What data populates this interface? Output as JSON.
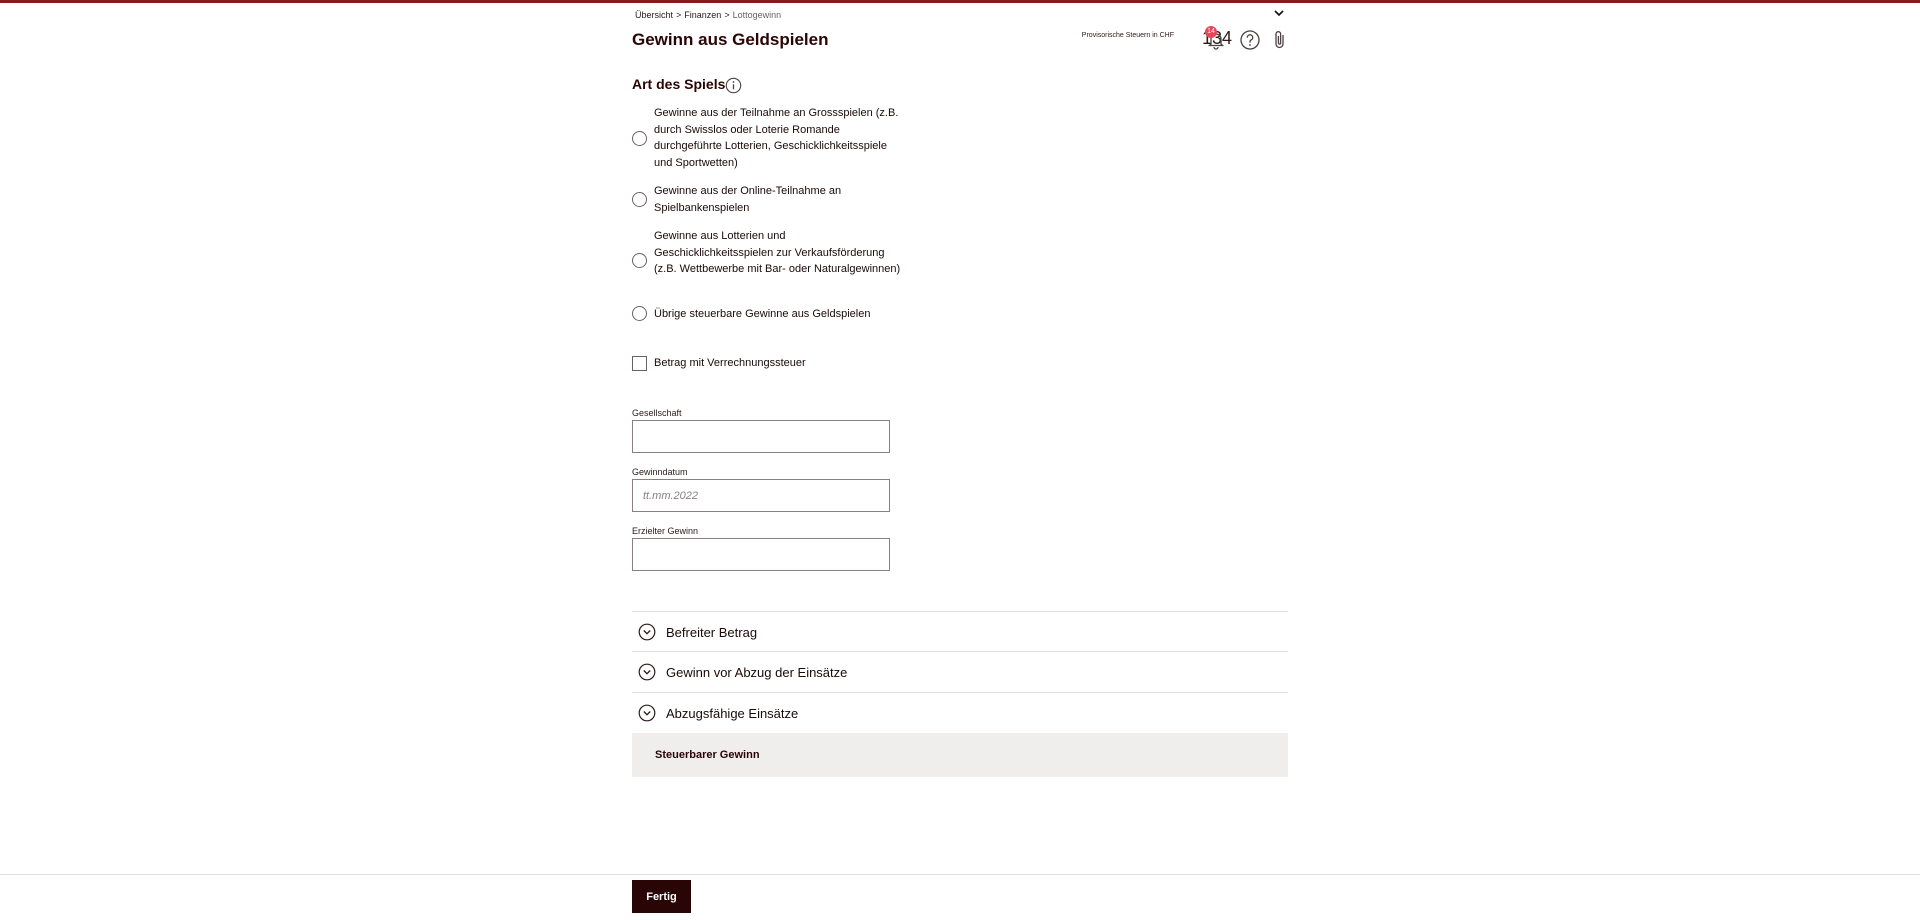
{
  "breadcrumb": {
    "items": [
      "Übersicht",
      "Finanzen"
    ],
    "current": "Lottogewinn",
    "separator": ">"
  },
  "header": {
    "title": "Gewinn aus Geldspielen",
    "tax_label": "Provisorische Steuern in CHF",
    "tax_value": "134",
    "notification_count": "14"
  },
  "section": {
    "title": "Art des Spiels"
  },
  "game_types": [
    "Gewinne aus der Teilnahme an Grossspielen (z.B. durch Swisslos oder Loterie Romande durchgeführte Lotterien, Geschicklichkeitsspiele und Sportwetten)",
    "Gewinne aus der Online-Teilnahme an Spielbankenspielen",
    "Gewinne aus Lotterien und Geschicklichkeitsspielen zur Verkaufsförderung (z.B. Wettbewerbe mit Bar- oder Naturalgewinnen)",
    "Übrige steuerbare Gewinne aus Geldspielen"
  ],
  "withholding_checkbox": {
    "label": "Betrag mit Verrechnungssteuer"
  },
  "fields": {
    "company": {
      "label": "Gesellschaft",
      "value": "",
      "placeholder": ""
    },
    "win_date": {
      "label": "Gewinndatum",
      "value": "",
      "placeholder": "tt.mm.2022"
    },
    "win_amount": {
      "label": "Erzielter Gewinn",
      "value": "",
      "placeholder": ""
    }
  },
  "accordion": [
    {
      "label": "Befreiter Betrag"
    },
    {
      "label": "Gewinn vor Abzug der Einsätze"
    },
    {
      "label": "Abzugsfähige Einsätze"
    }
  ],
  "summary": {
    "label": "Steuerbarer Gewinn"
  },
  "footer": {
    "done_label": "Fertig"
  },
  "colors": {
    "accent_dark": "#2a0505",
    "top_line": "#8a1a1a",
    "badge": "#e8455a",
    "summary_bg": "#f0eded"
  },
  "icons": {
    "header": [
      "bell-icon",
      "help-icon",
      "paperclip-icon",
      "chevron-down-icon"
    ],
    "section": "info-icon",
    "accordion": "chevron-circle-down-icon"
  }
}
